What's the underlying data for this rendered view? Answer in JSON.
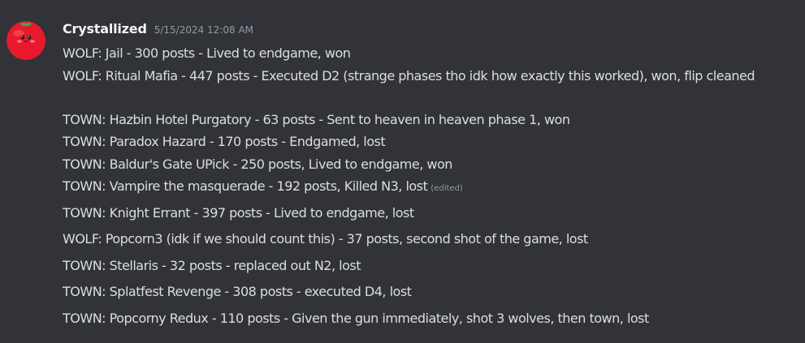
{
  "message": {
    "author": {
      "name": "Crystallized",
      "avatar_icon": "tomato-avatar-icon"
    },
    "timestamp": "5/15/2024 12:08 AM",
    "lines": [
      {
        "text": "WOLF: Jail - 300 posts - Lived to endgame, won"
      },
      {
        "text": "WOLF: Ritual Mafia - 447 posts - Executed D2 (strange phases tho idk how exactly this worked), won, flip cleaned"
      },
      {
        "text": "TOWN: Hazbin Hotel Purgatory - 63 posts - Sent to heaven in heaven phase 1, won"
      },
      {
        "text": "TOWN: Paradox Hazard - 170 posts - Endgamed, lost"
      },
      {
        "text": "TOWN: Baldur's Gate UPick - 250 posts, Lived to endgame, won"
      },
      {
        "text": "TOWN: Vampire the masquerade - 192 posts, Killed N3, lost",
        "edited": "(edited)"
      },
      {
        "text": "TOWN: Knight Errant - 397 posts - Lived to endgame, lost"
      },
      {
        "text": "WOLF: Popcorn3 (idk if we should count this) - 37 posts, second shot of the game, lost"
      },
      {
        "text": "TOWN: Stellaris - 32 posts - replaced out N2, lost"
      },
      {
        "text": "TOWN: Splatfest Revenge - 308 posts - executed D4, lost"
      },
      {
        "text": "TOWN: Popcorny Redux - 110 posts - Given the gun immediately, shot 3 wolves, then town, lost"
      }
    ]
  },
  "colors": {
    "background": "#313338",
    "text": "#dbdee1",
    "username": "#f2f3f5",
    "muted": "#949ba4",
    "avatar_red": "#e8192c"
  }
}
